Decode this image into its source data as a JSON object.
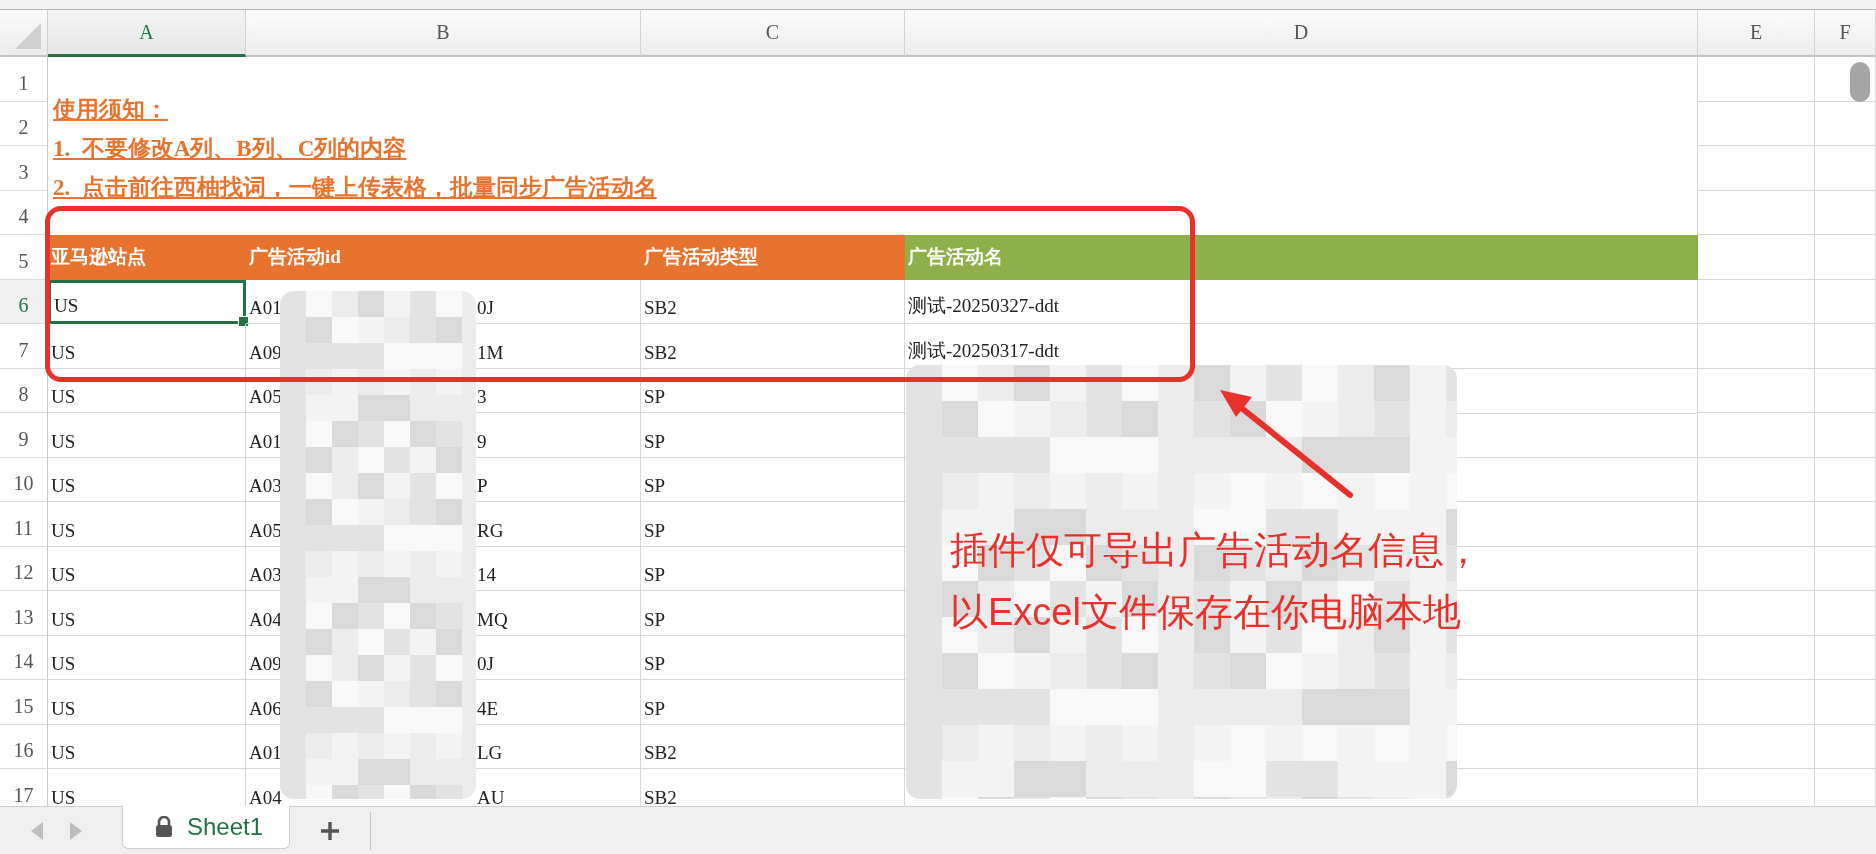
{
  "columns": [
    {
      "label": "A",
      "selected": true
    },
    {
      "label": "B",
      "selected": false
    },
    {
      "label": "C",
      "selected": false
    },
    {
      "label": "D",
      "selected": false
    },
    {
      "label": "E",
      "selected": false
    },
    {
      "label": "F",
      "selected": false
    }
  ],
  "row_numbers": [
    {
      "label": "1",
      "selected": false
    },
    {
      "label": "2",
      "selected": false
    },
    {
      "label": "3",
      "selected": false
    },
    {
      "label": "4",
      "selected": false
    },
    {
      "label": "5",
      "selected": false
    },
    {
      "label": "6",
      "selected": true
    },
    {
      "label": "7",
      "selected": false
    },
    {
      "label": "8",
      "selected": false
    },
    {
      "label": "9",
      "selected": false
    },
    {
      "label": "10",
      "selected": false
    },
    {
      "label": "11",
      "selected": false
    },
    {
      "label": "12",
      "selected": false
    },
    {
      "label": "13",
      "selected": false
    },
    {
      "label": "14",
      "selected": false
    },
    {
      "label": "15",
      "selected": false
    },
    {
      "label": "16",
      "selected": false
    },
    {
      "label": "17",
      "selected": false
    }
  ],
  "notes": {
    "title": "使用须知：",
    "lines": [
      "1.  不要修改A列、B列、C列的内容",
      "2.  点击前往西柚找词，一键上传表格，批量同步广告活动名"
    ]
  },
  "table": {
    "header": [
      {
        "text": "亚马逊站点",
        "color": "#e8732f"
      },
      {
        "text": "广告活动id",
        "color": "#e8732f"
      },
      {
        "text": "广告活动类型",
        "color": "#e8732f"
      },
      {
        "text": "广告活动名",
        "color": "#8db04b"
      }
    ],
    "rows": [
      {
        "site": "US",
        "id_start": "A01",
        "id_end": "0J",
        "type": "SB2",
        "name": "测试-20250327-ddt"
      },
      {
        "site": "US",
        "id_start": "A09",
        "id_end": "1M",
        "type": "SB2",
        "name": "测试-20250317-ddt"
      },
      {
        "site": "US",
        "id_start": "A05",
        "id_end": "3",
        "type": "SP"
      },
      {
        "site": "US",
        "id_start": "A01",
        "id_end": "9",
        "type": "SP"
      },
      {
        "site": "US",
        "id_start": "A03",
        "id_end": "P",
        "type": "SP"
      },
      {
        "site": "US",
        "id_start": "A05",
        "id_end": "RG",
        "type": "SP"
      },
      {
        "site": "US",
        "id_start": "A03",
        "id_end": "14",
        "type": "SP"
      },
      {
        "site": "US",
        "id_start": "A04",
        "id_end": "MQ",
        "type": "SP"
      },
      {
        "site": "US",
        "id_start": "A09",
        "id_end": "0J",
        "type": "SP"
      },
      {
        "site": "US",
        "id_start": "A06",
        "id_end": "4E",
        "type": "SP"
      },
      {
        "site": "US",
        "id_start": "A01",
        "id_end": "LG",
        "type": "SB2"
      },
      {
        "site": "US",
        "id_start": "A04",
        "id_end": "AU",
        "type": "SB2"
      }
    ]
  },
  "annotation": {
    "lines": [
      "插件仅可导出广告活动名信息，",
      "以Excel文件保存在你电脑本地"
    ]
  },
  "sheet_tabs": [
    {
      "label": "Sheet1",
      "selected": true,
      "locked": true
    }
  ]
}
